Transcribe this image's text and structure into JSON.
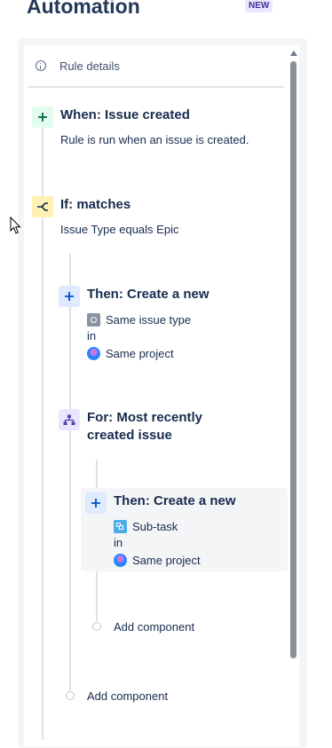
{
  "header": {
    "title": "Automation",
    "badge": "NEW"
  },
  "panel": {
    "rule_details_label": "Rule details"
  },
  "trigger": {
    "title": "When: Issue created",
    "description": "Rule is run when an issue is created."
  },
  "condition": {
    "title": "If: matches",
    "description": "Issue Type equals Epic"
  },
  "action1": {
    "title": "Then: Create a new",
    "issue_type": "Same issue type",
    "in_label": "in",
    "project": "Same project"
  },
  "branch": {
    "title_line1": "For: Most recently",
    "title_line2": "created issue"
  },
  "action2": {
    "title": "Then: Create a new",
    "issue_type": "Sub-task",
    "in_label": "in",
    "project": "Same project"
  },
  "add_component_inner": "Add component",
  "add_component_outer": "Add component",
  "colors": {
    "trigger_icon_bg": "#e3fcef",
    "condition_icon_bg": "#fff0b3",
    "action_icon_bg": "#deebff",
    "branch_icon_bg": "#eae6ff"
  },
  "icons": {
    "trigger": "plus-icon",
    "condition": "branch-condition-icon",
    "action": "plus-icon",
    "branch": "hierarchy-icon",
    "info": "info-icon"
  }
}
